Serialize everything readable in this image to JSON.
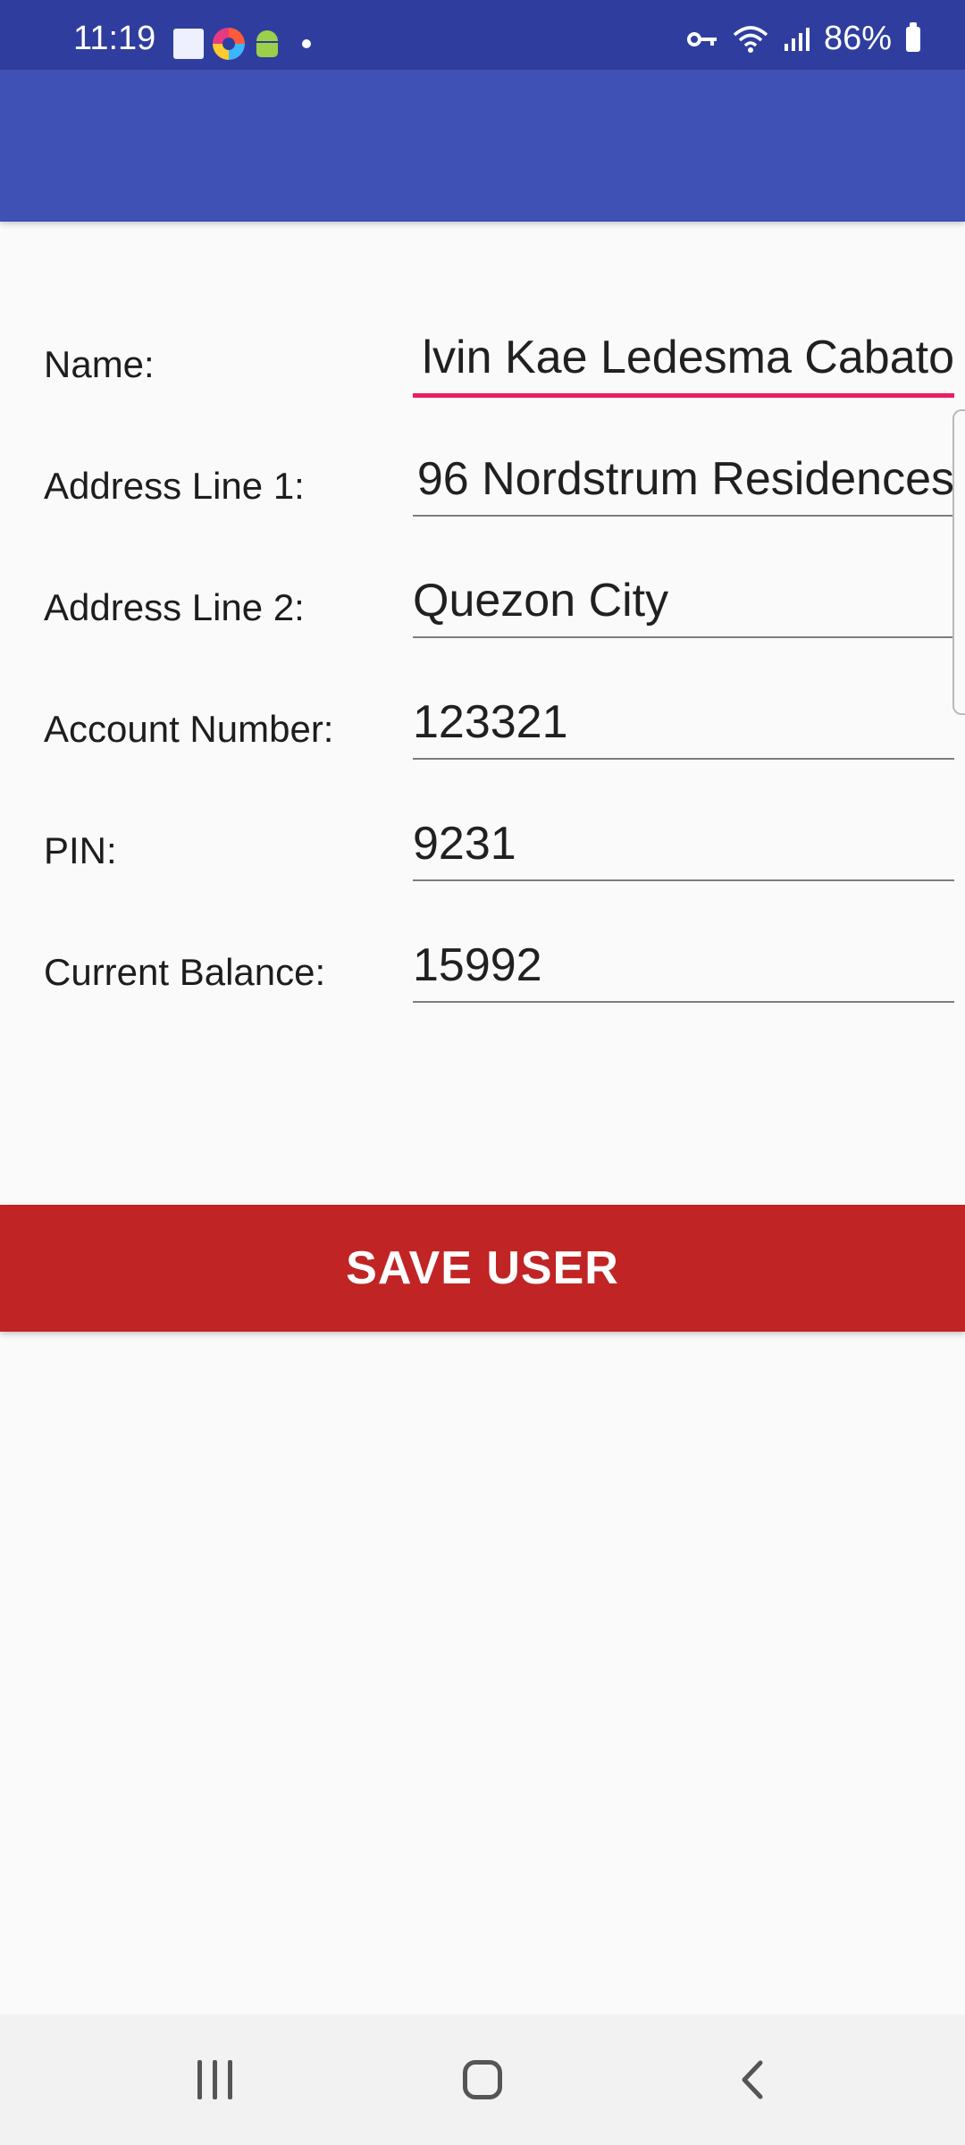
{
  "status_bar": {
    "time": "11:19",
    "battery_percent": "86%",
    "icons": [
      "square-app-icon",
      "browser-icon",
      "android-icon",
      "notification-dot-icon",
      "vpn-key-icon",
      "wifi-icon",
      "signal-icon",
      "battery-icon"
    ]
  },
  "colors": {
    "status_bar": "#2f3e9e",
    "app_bar": "#3f51b5",
    "accent_underline": "#e91e63",
    "save_button": "#c12424",
    "background": "#fafafa"
  },
  "form": {
    "fields": [
      {
        "label": "Name:",
        "value": "lvin Kae Ledesma Cabato"
      },
      {
        "label": "Address Line 1:",
        "value": "96 Nordstrum Residences"
      },
      {
        "label": "Address Line 2:",
        "value": "Quezon City"
      },
      {
        "label": "Account Number:",
        "value": "123321"
      },
      {
        "label": "PIN:",
        "value": "9231"
      },
      {
        "label": "Current Balance:",
        "value": "15992"
      }
    ]
  },
  "save_button": {
    "label": "SAVE USER"
  },
  "nav_bar": {
    "icons": [
      "recents-icon",
      "home-icon",
      "back-icon"
    ]
  }
}
